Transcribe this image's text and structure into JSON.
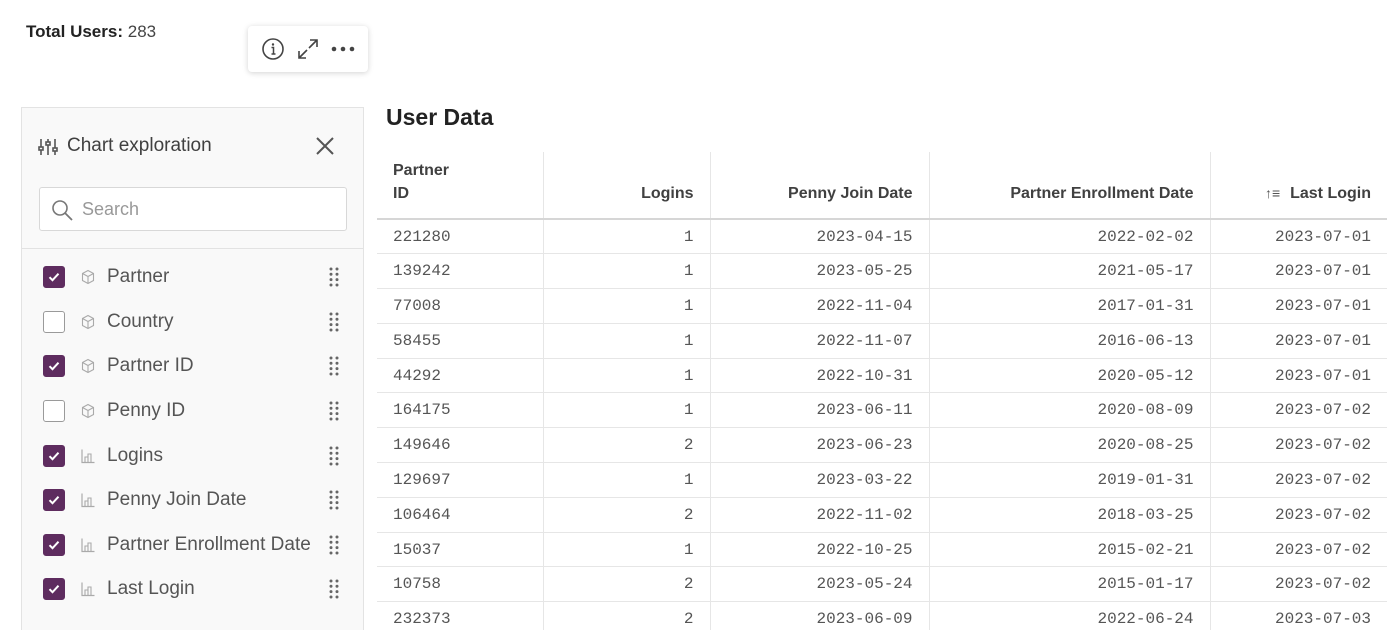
{
  "summary": {
    "total_users_label": "Total Users:",
    "total_users_value": "283"
  },
  "toolbar": {
    "icons": [
      "info-icon",
      "expand-icon",
      "more-icon"
    ]
  },
  "panel": {
    "title": "Chart exploration",
    "search_placeholder": "Search",
    "fields": [
      {
        "label": "Partner",
        "checked": true,
        "type": "dimension"
      },
      {
        "label": "Country",
        "checked": false,
        "type": "dimension"
      },
      {
        "label": "Partner ID",
        "checked": true,
        "type": "dimension"
      },
      {
        "label": "Penny ID",
        "checked": false,
        "type": "dimension"
      },
      {
        "label": "Logins",
        "checked": true,
        "type": "measure"
      },
      {
        "label": "Penny Join Date",
        "checked": true,
        "type": "measure"
      },
      {
        "label": "Partner Enrollment Date",
        "checked": true,
        "type": "measure"
      },
      {
        "label": "Last Login",
        "checked": true,
        "type": "measure"
      }
    ]
  },
  "table": {
    "title": "User Data",
    "columns": [
      "Partner ID",
      "Logins",
      "Penny Join Date",
      "Partner Enrollment Date",
      "Last Login"
    ],
    "sorted_column": "Last Login",
    "rows": [
      [
        "221280",
        "1",
        "2023-04-15",
        "2022-02-02",
        "2023-07-01"
      ],
      [
        "139242",
        "1",
        "2023-05-25",
        "2021-05-17",
        "2023-07-01"
      ],
      [
        "77008",
        "1",
        "2022-11-04",
        "2017-01-31",
        "2023-07-01"
      ],
      [
        "58455",
        "1",
        "2022-11-07",
        "2016-06-13",
        "2023-07-01"
      ],
      [
        "44292",
        "1",
        "2022-10-31",
        "2020-05-12",
        "2023-07-01"
      ],
      [
        "164175",
        "1",
        "2023-06-11",
        "2020-08-09",
        "2023-07-02"
      ],
      [
        "149646",
        "2",
        "2023-06-23",
        "2020-08-25",
        "2023-07-02"
      ],
      [
        "129697",
        "1",
        "2023-03-22",
        "2019-01-31",
        "2023-07-02"
      ],
      [
        "106464",
        "2",
        "2022-11-02",
        "2018-03-25",
        "2023-07-02"
      ],
      [
        "15037",
        "1",
        "2022-10-25",
        "2015-02-21",
        "2023-07-02"
      ],
      [
        "10758",
        "2",
        "2023-05-24",
        "2015-01-17",
        "2023-07-02"
      ],
      [
        "232373",
        "2",
        "2023-06-09",
        "2022-06-24",
        "2023-07-03"
      ]
    ]
  },
  "colors": {
    "checkbox_accent": "#5e2c5f"
  }
}
